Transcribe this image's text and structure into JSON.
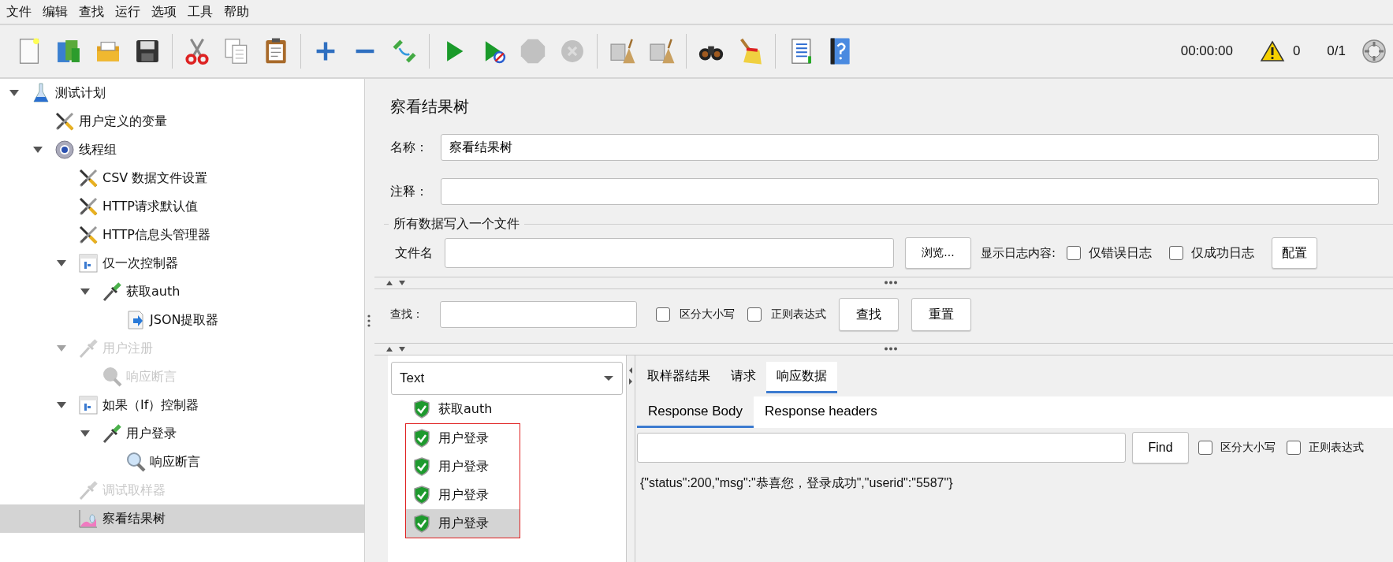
{
  "menu": [
    "文件",
    "编辑",
    "查找",
    "运行",
    "选项",
    "工具",
    "帮助"
  ],
  "toolbar": [
    {
      "kind": "new",
      "disabled": false
    },
    {
      "kind": "templates",
      "disabled": false
    },
    {
      "kind": "open",
      "disabled": false
    },
    {
      "kind": "save",
      "disabled": false
    },
    {
      "kind": "sep"
    },
    {
      "kind": "cut",
      "disabled": false
    },
    {
      "kind": "copy",
      "disabled": false
    },
    {
      "kind": "paste",
      "disabled": false
    },
    {
      "kind": "sep"
    },
    {
      "kind": "expand",
      "disabled": false
    },
    {
      "kind": "collapse",
      "disabled": false
    },
    {
      "kind": "toggle",
      "disabled": false
    },
    {
      "kind": "sep"
    },
    {
      "kind": "start",
      "disabled": false
    },
    {
      "kind": "start-no-pause",
      "disabled": false
    },
    {
      "kind": "stop",
      "disabled": true
    },
    {
      "kind": "shutdown",
      "disabled": true
    },
    {
      "kind": "sep"
    },
    {
      "kind": "clear",
      "disabled": false
    },
    {
      "kind": "clear-all",
      "disabled": false
    },
    {
      "kind": "sep"
    },
    {
      "kind": "search",
      "disabled": false
    },
    {
      "kind": "reset-search",
      "disabled": false
    },
    {
      "kind": "sep"
    },
    {
      "kind": "functions",
      "disabled": false
    },
    {
      "kind": "help",
      "disabled": false
    }
  ],
  "status": {
    "elapsed": "00:00:00",
    "warnings": "0",
    "threads": "0/1"
  },
  "tree": [
    {
      "label": "测试计划",
      "kind": "plan",
      "expanded": true,
      "selected": false,
      "disabled": false,
      "children": [
        {
          "label": "用户定义的变量",
          "kind": "config",
          "selected": false,
          "disabled": false
        },
        {
          "label": "线程组",
          "kind": "threadgroup",
          "expanded": true,
          "selected": false,
          "disabled": false,
          "children": [
            {
              "label": "CSV 数据文件设置",
              "kind": "config",
              "selected": false,
              "disabled": false
            },
            {
              "label": "HTTP请求默认值",
              "kind": "config",
              "selected": false,
              "disabled": false
            },
            {
              "label": "HTTP信息头管理器",
              "kind": "config",
              "selected": false,
              "disabled": false
            },
            {
              "label": "仅一次控制器",
              "kind": "controller",
              "expanded": true,
              "selected": false,
              "disabled": false,
              "children": [
                {
                  "label": "获取auth",
                  "kind": "sampler",
                  "expanded": true,
                  "selected": false,
                  "disabled": false,
                  "children": [
                    {
                      "label": "JSON提取器",
                      "kind": "extractor",
                      "selected": false,
                      "disabled": false
                    }
                  ]
                }
              ]
            },
            {
              "label": "用户注册",
              "kind": "sampler",
              "expanded": true,
              "selected": false,
              "disabled": true,
              "children": [
                {
                  "label": "响应断言",
                  "kind": "assertion",
                  "selected": false,
                  "disabled": true
                }
              ]
            },
            {
              "label": "如果（If）控制器",
              "kind": "controller",
              "expanded": true,
              "selected": false,
              "disabled": false,
              "children": [
                {
                  "label": "用户登录",
                  "kind": "sampler",
                  "expanded": true,
                  "selected": false,
                  "disabled": false,
                  "children": [
                    {
                      "label": "响应断言",
                      "kind": "assertion",
                      "selected": false,
                      "disabled": false
                    }
                  ]
                }
              ]
            },
            {
              "label": "调试取样器",
              "kind": "sampler",
              "selected": false,
              "disabled": true
            },
            {
              "label": "察看结果树",
              "kind": "listener",
              "selected": true,
              "disabled": false
            }
          ]
        }
      ]
    }
  ],
  "panel": {
    "title": "察看结果树",
    "name_label": "名称：",
    "name_value": "察看结果树",
    "comment_label": "注释：",
    "file_section": "所有数据写入一个文件",
    "file_label": "文件名",
    "browse": "浏览...",
    "log_label": "显示日志内容:",
    "log_options": [
      {
        "label": "仅错误日志",
        "checked": false
      },
      {
        "label": "仅成功日志",
        "checked": false
      }
    ],
    "configure": "配置",
    "search_label": "查找：",
    "search_options": [
      {
        "label": "区分大小写",
        "checked": false
      },
      {
        "label": "正则表达式",
        "checked": false
      }
    ],
    "search_button": "查找",
    "reset_button": "重置"
  },
  "renderer": "Text",
  "results": [
    {
      "label": "获取auth",
      "selected": false,
      "boxed": false
    },
    {
      "label": "用户登录",
      "selected": false,
      "boxed": true
    },
    {
      "label": "用户登录",
      "selected": false,
      "boxed": true
    },
    {
      "label": "用户登录",
      "selected": false,
      "boxed": true
    },
    {
      "label": "用户登录",
      "selected": true,
      "boxed": true
    }
  ],
  "tabs": [
    {
      "label": "取样器结果",
      "selected": false
    },
    {
      "label": "请求",
      "selected": false
    },
    {
      "label": "响应数据",
      "selected": true
    }
  ],
  "subtabs": [
    {
      "label": "Response Body",
      "selected": true
    },
    {
      "label": "Response headers",
      "selected": false
    }
  ],
  "response_search": {
    "button": "Find",
    "options": [
      {
        "label": "区分大小写",
        "checked": false
      },
      {
        "label": "正则表达式",
        "checked": false
      }
    ]
  },
  "response_body": "{\"status\":200,\"msg\":\"恭喜您，登录成功\",\"userid\":\"5587\"}"
}
